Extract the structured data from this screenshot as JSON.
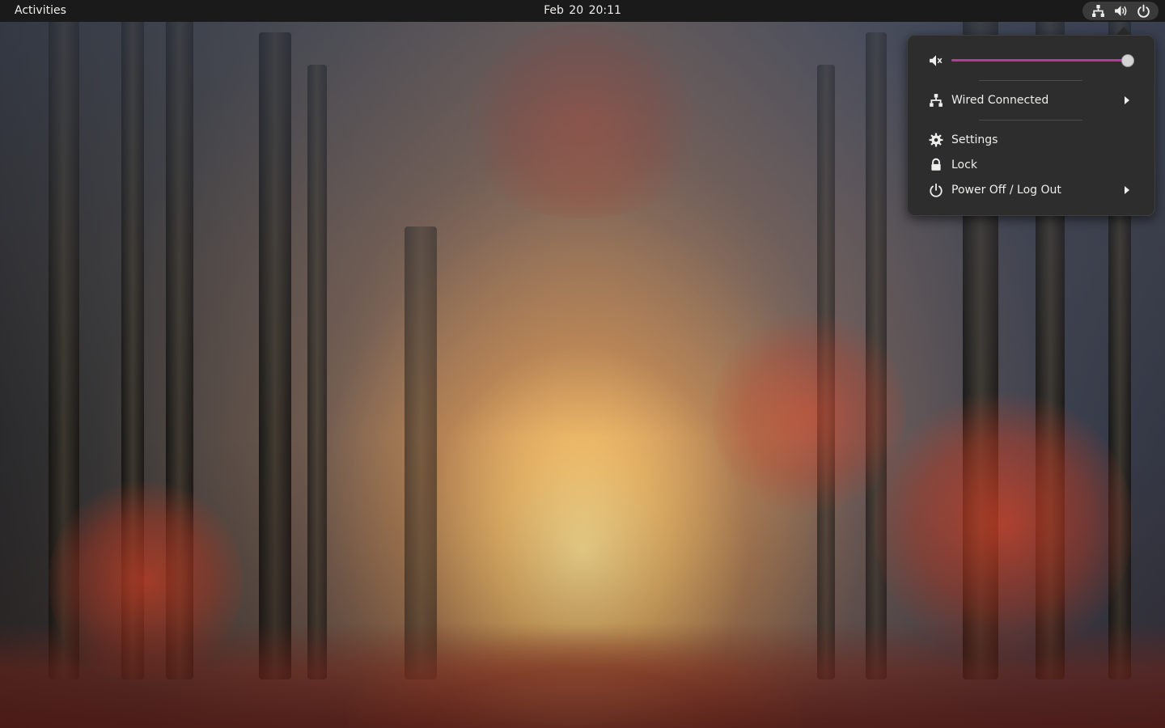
{
  "topbar": {
    "activities_label": "Activities",
    "clock": "Feb 20  20:11",
    "tray_icons": [
      "network-wired-icon",
      "speaker-volume-icon",
      "power-icon"
    ]
  },
  "system_menu": {
    "volume": {
      "icon": "speaker-muted-icon",
      "level": 0.97
    },
    "items": [
      {
        "icon": "network-wired-icon",
        "label": "Wired Connected",
        "has_submenu": true
      },
      {
        "icon": "gear-icon",
        "label": "Settings",
        "has_submenu": false
      },
      {
        "icon": "lock-icon",
        "label": "Lock",
        "has_submenu": false
      },
      {
        "icon": "power-icon",
        "label": "Power Off / Log Out",
        "has_submenu": true
      }
    ]
  },
  "colors": {
    "topbar_bg": "#1a1a1a",
    "menu_bg": "#2d2d2d",
    "slider_accent": "#b43b9e",
    "text": "#eeeeec"
  }
}
